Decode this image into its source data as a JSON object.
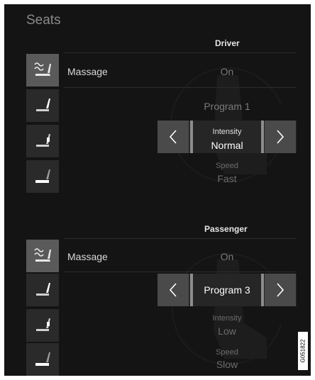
{
  "screen": {
    "title": "Seats"
  },
  "driver": {
    "title": "Driver",
    "massage_label": "Massage",
    "massage_value": "On",
    "program": "Program 1",
    "intensity_label": "Intensity",
    "intensity_value": "Normal",
    "speed_label": "Speed",
    "speed_value": "Fast",
    "icons": [
      "seat-massage-icon",
      "seat-backrest-icon",
      "seat-lumbar-icon",
      "seat-cushion-icon"
    ]
  },
  "passenger": {
    "title": "Passenger",
    "massage_label": "Massage",
    "massage_value": "On",
    "program": "Program 3",
    "intensity_label": "Intensity",
    "intensity_value": "Low",
    "speed_label": "Speed",
    "speed_value": "Slow",
    "icons": [
      "seat-massage-icon",
      "seat-backrest-icon",
      "seat-lumbar-icon",
      "seat-cushion-icon"
    ]
  },
  "image_code": "G051822"
}
